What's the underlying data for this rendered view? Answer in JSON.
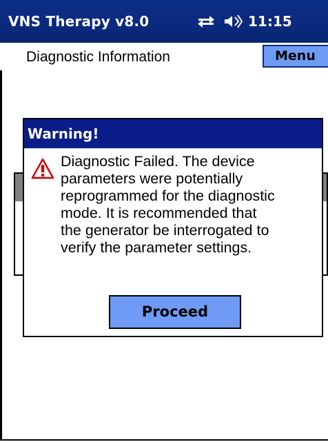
{
  "title_bar": {
    "app_title": "VNS Therapy v8.0",
    "clock": "11:15",
    "connectivity_icon": "connectivity-icon",
    "volume_icon": "volume-icon"
  },
  "header": {
    "page_title": "Diagnostic Information",
    "menu_label": "Menu"
  },
  "dialog": {
    "title": "Warning!",
    "icon": "warning-icon",
    "message": "Diagnostic Failed. The device\nparameters were potentially\nreprogrammed for the diagnostic\nmode. It is recommended that\nthe generator be interrogated to\nverify the parameter settings.",
    "proceed_label": "Proceed"
  },
  "colors": {
    "title_bar": "#0a2a7e",
    "dialog_header": "#0b1d88",
    "button_fill": "#6f9bf4",
    "warning_red": "#cc0000"
  }
}
